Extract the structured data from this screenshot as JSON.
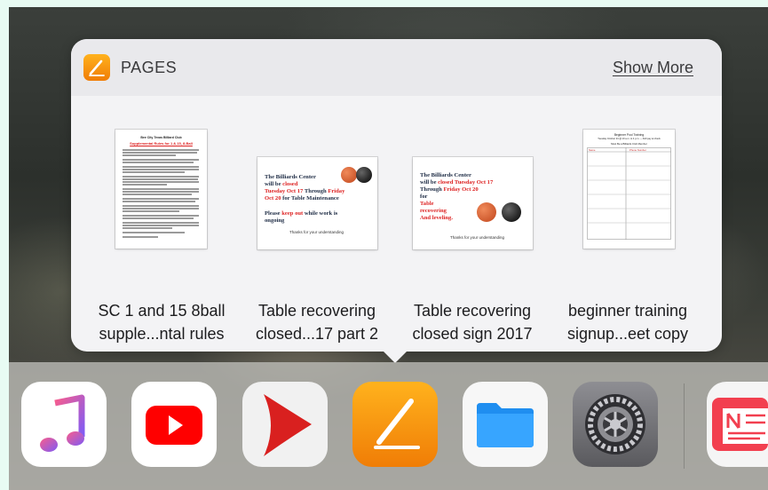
{
  "widget": {
    "app_name": "PAGES",
    "show_more_label": "Show More"
  },
  "documents": [
    {
      "title_line1": "SC 1 and 15 8ball",
      "title_line2": "supple...ntal rules",
      "thumb_text": {
        "org": "Bee City Texas Billiard Club",
        "heading": "Supplemental Rules for 1 & 15, 8-Ball"
      }
    },
    {
      "title_line1": "Table recovering",
      "title_line2": "closed...17 part 2",
      "thumb_text": {
        "line1": "The Billiards Center",
        "line2a": "will be ",
        "line2b": "closed",
        "line3": "Tuesday Oct 17",
        "line3b": " Through ",
        "line3c": "Friday",
        "line4": "Oct 20",
        "line4b": " for Table Maintenance",
        "line5a": "Please ",
        "line5b": "keep out",
        "line5c": " while work is",
        "line6": "ongoing",
        "footer": "Thanks for your understanding"
      }
    },
    {
      "title_line1": "Table recovering",
      "title_line2": "closed sign 2017",
      "thumb_text": {
        "line1": "The Billiards Center",
        "line2a": "will be ",
        "line2b": "closed Tuesday Oct 17",
        "line3a": "Through ",
        "line3b": "Friday Oct 20",
        "line4": "for",
        "line5": "Table",
        "line6": "recovering",
        "line7": "And leveling.",
        "footer": "Thanks for your understanding"
      }
    },
    {
      "title_line1": "beginner training",
      "title_line2": "signup...eet copy",
      "thumb_text": {
        "title": "Beginner Pool Training",
        "subtitle": "Tuesday October 24 @ 10 a.m. to 4 p.m. — $10 pay at check",
        "note": "Must Be a Billiards Club Member",
        "col1": "Name",
        "col2": "Phone Number"
      }
    }
  ],
  "dock": {
    "apps": [
      "music-app-icon",
      "youtube-app-icon",
      "infuse-app-icon",
      "pages-app-icon",
      "files-app-icon",
      "settings-app-icon",
      "news-app-icon"
    ]
  }
}
